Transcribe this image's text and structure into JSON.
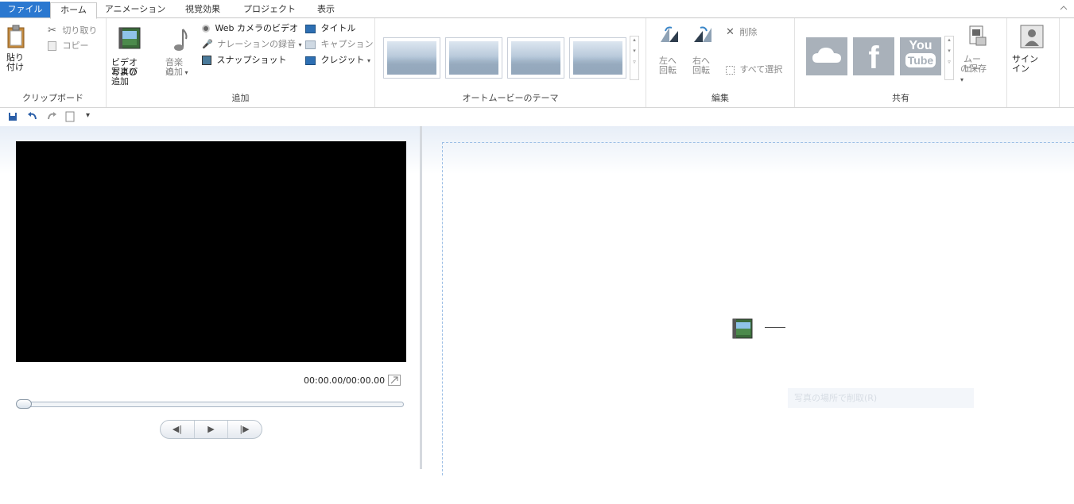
{
  "tabs": [
    {
      "label": "ファイル"
    },
    {
      "label": "ホーム"
    },
    {
      "label": "アニメーション"
    },
    {
      "label": "視覚効果"
    },
    {
      "label": "プロジェクト"
    },
    {
      "label": "表示"
    }
  ],
  "colors": {
    "file_tab": "#2b78d0",
    "video_bg": "#000000",
    "accent_border": "#9ec0e6"
  },
  "clipboard": {
    "paste_label_1": "貼り",
    "paste_label_2": "付け",
    "cut": "切り取り",
    "copy": "コピー",
    "group": "クリップボード"
  },
  "add": {
    "add_media_1": "ビデオおよび",
    "add_media_2": "写真の追加",
    "add_music_1": "音楽の",
    "add_music_2": "追加",
    "webcam": "Web カメラのビデオ",
    "narration": "ナレーションの録音",
    "snapshot": "スナップショット",
    "title": "タイトル",
    "caption": "キャプション",
    "credit": "クレジット",
    "group": "追加"
  },
  "themes": {
    "group": "オートムービーのテーマ"
  },
  "edit": {
    "rotate_left_1": "左へ",
    "rotate_left_2": "回転",
    "rotate_right_1": "右へ",
    "rotate_right_2": "回転",
    "delete": "削除",
    "select_all": "すべて選択",
    "group": "編集"
  },
  "share": {
    "youtube_1": "You",
    "youtube_2": "Tube",
    "save_movie_1": "ムービー",
    "save_movie_2": "の保存",
    "group": "共有"
  },
  "signin": {
    "label": "サインイン"
  },
  "player": {
    "time": "00:00.00/00:00.00"
  },
  "storyboard": {
    "hint": "写真の場所で削取(R)"
  }
}
